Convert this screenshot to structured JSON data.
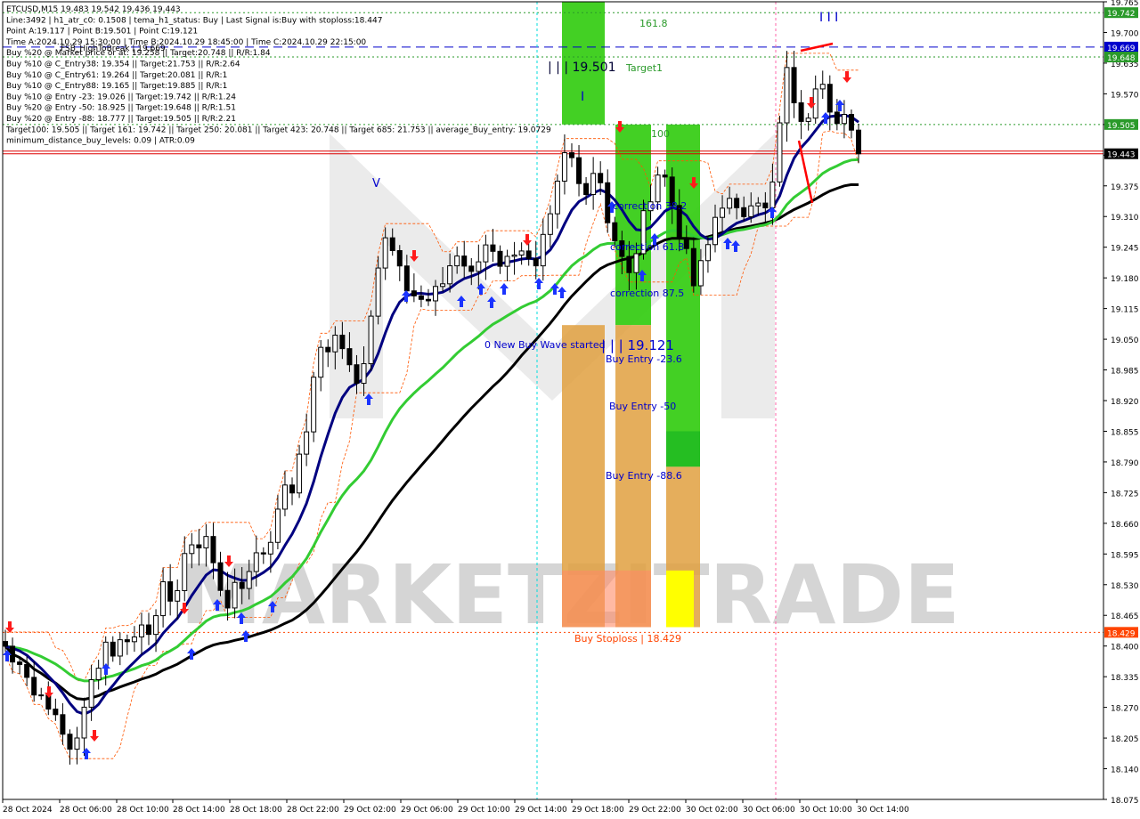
{
  "header": {
    "lines": [
      "ETCUSD,M15  19.483 19.542 19.436 19.443",
      "Line:3492 | h1_atr_c0: 0.1508 | tema_h1_status: Buy | Last Signal is:Buy with stoploss:18.447",
      "Point A:19.117 | Point B:19.501 | Point C:19.121",
      "Time A:2024.10.29 15:30:00 | Time B:2024.10.29 18:45:00 | Time C:2024.10.29 22:15:00",
      "Buy %20 @ Market price or at: 19.258 || Target:20.748 || R/R:1.84",
      "Buy %10 @ C_Entry38: 19.354 || Target:21.753 || R/R:2.64",
      "Buy %10 @ C_Entry61: 19.264 || Target:20.081 || R/R:1",
      "Buy %10 @ C_Entry88: 19.165 || Target:19.885 || R/R:1",
      "Buy %10 @ Entry -23: 19.026 || Target:19.742 || R/R:1.24",
      "Buy %20 @ Entry -50: 18.925 || Target:19.648 || R/R:1.51",
      "Buy %20 @ Entry -88: 18.777 || Target:19.505 || R/R:2.21",
      "Target100: 19.505 || Target 161: 19.742 || Target 250: 20.081 || Target 423: 20.748 || Target 685: 21.753 || average_Buy_entry: 19.0729",
      "minimum_distance_buy_levels: 0.09 | ATR:0.09"
    ],
    "fsb_label": "FSB_HighToBreak | 19.669"
  },
  "watermark": "MARKETZITRADE",
  "colors": {
    "green_zone": "#33cc11",
    "orange_zone": "#e0a040",
    "yellow_box": "#ffff00",
    "salmon_box": "#ff8a66",
    "ema_green": "#33cc33",
    "tema_blue": "#000080",
    "sma_black": "#000000",
    "buy_arrow": "#1a33ff",
    "sell_arrow": "#ff1a1a",
    "level_green": "#2a9a2a",
    "level_blue": "#0000cc",
    "level_red": "#dd0000",
    "level_orange": "#ff4400"
  },
  "chart_data": {
    "type": "candlestick",
    "symbol": "ETCUSD",
    "timeframe": "M15",
    "ohlc_last": {
      "open": 19.483,
      "high": 19.542,
      "low": 19.436,
      "close": 19.443
    },
    "ylim": [
      18.075,
      19.765
    ],
    "y_ticks": [
      "19.765",
      "19.700",
      "19.635",
      "19.570",
      "19.505",
      "19.440",
      "19.375",
      "19.310",
      "19.245",
      "19.180",
      "19.115",
      "19.050",
      "18.985",
      "18.920",
      "18.855",
      "18.790",
      "18.725",
      "18.660",
      "18.595",
      "18.530",
      "18.465",
      "18.400",
      "18.335",
      "18.270",
      "18.205",
      "18.140",
      "18.075"
    ],
    "x_ticks": [
      "28 Oct 2024",
      "28 Oct 06:00",
      "28 Oct 10:00",
      "28 Oct 14:00",
      "28 Oct 18:00",
      "28 Oct 22:00",
      "29 Oct 02:00",
      "29 Oct 06:00",
      "29 Oct 10:00",
      "29 Oct 14:00",
      "29 Oct 18:00",
      "29 Oct 22:00",
      "30 Oct 02:00",
      "30 Oct 06:00",
      "30 Oct 10:00",
      "30 Oct 14:00"
    ],
    "price_path": [
      18.4,
      18.36,
      18.38,
      18.33,
      18.28,
      18.31,
      18.25,
      18.22,
      18.18,
      18.21,
      18.26,
      18.33,
      18.38,
      18.42,
      18.37,
      18.44,
      18.4,
      18.45,
      18.43,
      18.48,
      18.52,
      18.47,
      18.55,
      18.62,
      18.58,
      18.66,
      18.6,
      18.52,
      18.48,
      18.55,
      18.5,
      18.57,
      18.62,
      18.58,
      18.66,
      18.75,
      18.7,
      18.8,
      18.86,
      18.95,
      19.05,
      19.0,
      19.08,
      19.02,
      18.97,
      18.95,
      19.05,
      19.2,
      19.28,
      19.24,
      19.22,
      19.16,
      19.14,
      19.12,
      19.13,
      19.16,
      19.2,
      19.23,
      19.21,
      19.18,
      19.22,
      19.26,
      19.24,
      19.2,
      19.23,
      19.26,
      19.22,
      19.18,
      19.25,
      19.3,
      19.38,
      19.45,
      19.42,
      19.35,
      19.4,
      19.42,
      19.32,
      19.27,
      19.22,
      19.18,
      19.25,
      19.32,
      19.38,
      19.42,
      19.36,
      19.3,
      19.24,
      19.16,
      19.2,
      19.25,
      19.32,
      19.35,
      19.33,
      19.3,
      19.34,
      19.37,
      19.31,
      19.36,
      19.5,
      19.62,
      19.55,
      19.48,
      19.56,
      19.63,
      19.58,
      19.5,
      19.52,
      19.483,
      19.443
    ],
    "indicators": [
      {
        "name": "Moving average (green)",
        "style": "line"
      },
      {
        "name": "TEMA (navy)",
        "style": "line"
      },
      {
        "name": "Moving average (black)",
        "style": "line"
      },
      {
        "name": "Envelope (orange dashed)",
        "style": "dashed"
      }
    ],
    "levels": [
      {
        "value": 19.742,
        "label": "19.742",
        "style": "dotted",
        "color": "#2a9a2a"
      },
      {
        "value": 19.669,
        "label": "19.669",
        "style": "dashed",
        "color": "#0000cc"
      },
      {
        "value": 19.648,
        "label": "19.648",
        "style": "dotted",
        "color": "#2a9a2a"
      },
      {
        "value": 19.505,
        "label": "19.505",
        "style": "dotted",
        "color": "#2a9a2a"
      },
      {
        "value": 19.443,
        "label": "19.443",
        "style": "solid",
        "color": "#dd0000"
      },
      {
        "value": 18.429,
        "label": "18.429",
        "style": "dotted",
        "color": "#ff4400"
      }
    ],
    "zones": [
      {
        "kind": "green",
        "y_top": 19.765,
        "y_bottom": 19.505
      },
      {
        "kind": "green",
        "y_top": 19.505,
        "y_bottom": 19.08
      },
      {
        "kind": "green",
        "y_top": 19.505,
        "y_bottom": 18.78
      },
      {
        "kind": "orange",
        "y_top": 19.08,
        "y_bottom": 18.44
      },
      {
        "kind": "orange",
        "y_top": 19.08,
        "y_bottom": 18.44
      },
      {
        "kind": "orange",
        "y_top": 18.78,
        "y_bottom": 18.44
      },
      {
        "kind": "yellow",
        "y_top": 18.56,
        "y_bottom": 18.44
      }
    ],
    "annotations": [
      {
        "text": "161.8"
      },
      {
        "text": "| | | 19.501"
      },
      {
        "text": "Target1"
      },
      {
        "text": "100"
      },
      {
        "text": "correction 38.2"
      },
      {
        "text": "correction 61.8"
      },
      {
        "text": "correction 87.5"
      },
      {
        "text": "0 New Buy Wave started"
      },
      {
        "text": "| | | 19.121"
      },
      {
        "text": "Buy Entry -23.6"
      },
      {
        "text": "Buy Entry -50"
      },
      {
        "text": "Buy Entry -88.6"
      },
      {
        "text": "Buy Stoploss | 18.429"
      },
      {
        "text": "V"
      },
      {
        "text": "I"
      },
      {
        "text": "I I I"
      }
    ]
  }
}
